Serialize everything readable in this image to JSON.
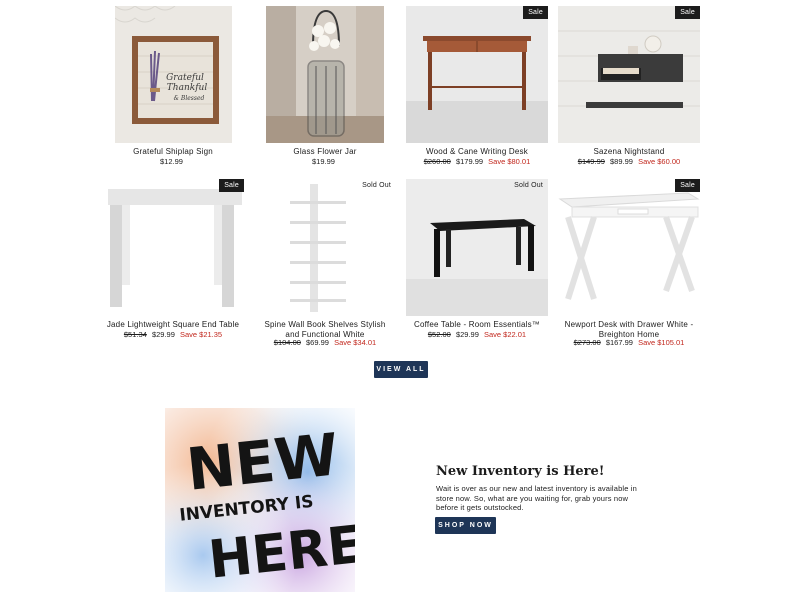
{
  "products": [
    {
      "name": "Grateful Shiplap Sign",
      "price": "$12.99",
      "old_price": "",
      "save": "",
      "badge": ""
    },
    {
      "name": "Glass Flower Jar",
      "price": "$19.99",
      "old_price": "",
      "save": "",
      "badge": ""
    },
    {
      "name": "Wood & Cane Writing Desk",
      "price": "$179.99",
      "old_price": "$260.00",
      "save": "Save $80.01",
      "badge": "Sale"
    },
    {
      "name": "Sazena Nightstand",
      "price": "$89.99",
      "old_price": "$149.99",
      "save": "Save $60.00",
      "badge": "Sale"
    },
    {
      "name": "Jade Lightweight Square End Table",
      "price": "$29.99",
      "old_price": "$51.34",
      "save": "Save $21.35",
      "badge": "Sale"
    },
    {
      "name": "Spine Wall Book Shelves Stylish and Functional White",
      "price": "$69.99",
      "old_price": "$104.00",
      "save": "Save $34.01",
      "badge": "Sold Out"
    },
    {
      "name": "Coffee Table - Room Essentials™",
      "price": "$29.99",
      "old_price": "$52.00",
      "save": "Save $22.01",
      "badge": "Sold Out"
    },
    {
      "name": "Newport Desk with Drawer White - Breighton Home",
      "price": "$167.99",
      "old_price": "$273.00",
      "save": "Save $105.01",
      "badge": "Sale"
    }
  ],
  "sign_text": [
    "Grateful",
    "Thankful",
    "& Blessed"
  ],
  "view_all_label": "VIEW ALL",
  "promo": {
    "image_text": [
      "NEW",
      "INVENTORY IS",
      "HERE!"
    ],
    "title": "New Inventory is Here!",
    "body": "Wait is over as our new and latest inventory is available in store now. So, what are you waiting for, grab yours now before it gets outstocked.",
    "button_label": "SHOP NOW"
  },
  "colors": {
    "button": "#1e3557",
    "sale_badge": "#1c1c1c",
    "save_text": "#c2281e"
  }
}
